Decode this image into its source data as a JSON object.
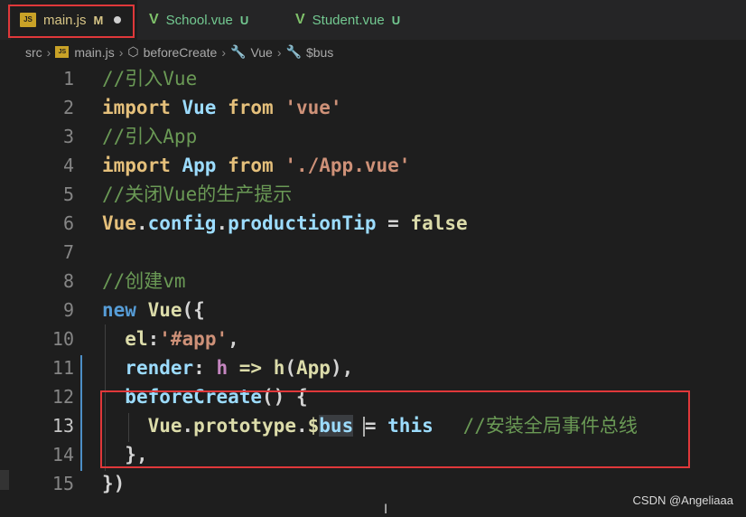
{
  "tabs": [
    {
      "label": "main.js",
      "status": "M",
      "icon": "js-icon",
      "dirty": true,
      "active": true
    },
    {
      "label": "School.vue",
      "status": "U",
      "icon": "vue-icon",
      "active": false
    },
    {
      "label": "Student.vue",
      "status": "U",
      "icon": "vue-icon",
      "active": false
    }
  ],
  "breadcrumb": {
    "items": [
      "src",
      "main.js",
      "beforeCreate",
      "Vue",
      "$bus"
    ]
  },
  "editor": {
    "current_line": 13,
    "lines": [
      {
        "n": "1"
      },
      {
        "n": "2"
      },
      {
        "n": "3"
      },
      {
        "n": "4"
      },
      {
        "n": "5"
      },
      {
        "n": "6"
      },
      {
        "n": "7"
      },
      {
        "n": "8"
      },
      {
        "n": "9"
      },
      {
        "n": "10"
      },
      {
        "n": "11"
      },
      {
        "n": "12"
      },
      {
        "n": "13"
      },
      {
        "n": "14"
      },
      {
        "n": "15"
      }
    ],
    "code": {
      "l1_comment": "//引入Vue",
      "l2_import": "import",
      "l2_vue": "Vue",
      "l2_from": "from",
      "l2_str": "'vue'",
      "l3_comment": "//引入App",
      "l4_import": "import",
      "l4_app": "App",
      "l4_from": "from",
      "l4_str": "'./App.vue'",
      "l5_comment": "//关闭Vue的生产提示",
      "l6_vue": "Vue",
      "l6_config": "config",
      "l6_prod": "productionTip",
      "l6_eq": " = ",
      "l6_false": "false",
      "l8_comment": "//创建vm",
      "l9_new": "new",
      "l9_vue": "Vue",
      "l9_punc": "({",
      "l10_el": "el",
      "l10_colon": ":",
      "l10_str": "'#app'",
      "l10_comma": ",",
      "l11_render": "render",
      "l11_colon": ": ",
      "l11_h": "h",
      "l11_arrow": " => ",
      "l11_h2": "h",
      "l11_paren_open": "(",
      "l11_app": "App",
      "l11_paren_close": "),",
      "l12_before": "beforeCreate",
      "l12_punc": "() {",
      "l13_vue": "Vue",
      "l13_proto": "prototype",
      "l13_dollar": "$",
      "l13_bus": "bus",
      "l13_eq": " = ",
      "l13_this": "this",
      "l13_comment": " //安装全局事件总线",
      "l14_punc": "},",
      "l15_punc": "})"
    }
  },
  "watermark": "CSDN @Angeliaaa"
}
